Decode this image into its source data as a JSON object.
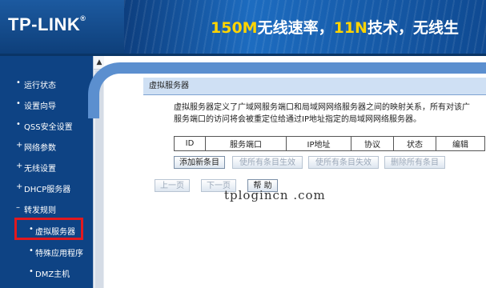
{
  "header": {
    "logo": "TP-LINK",
    "logo_reg": "®",
    "slogan_a": "150M",
    "slogan_b": "无线速率，",
    "slogan_c": "11N",
    "slogan_d": "技术，无线生"
  },
  "sidebar": {
    "items": [
      {
        "bullet": "•",
        "label": "运行状态"
      },
      {
        "bullet": "•",
        "label": "设置向导"
      },
      {
        "bullet": "•",
        "label": "QSS安全设置"
      },
      {
        "bullet": "+",
        "label": "网络参数"
      },
      {
        "bullet": "+",
        "label": "无线设置"
      },
      {
        "bullet": "+",
        "label": "DHCP服务器"
      },
      {
        "bullet": "–",
        "label": "转发规则"
      },
      {
        "bullet": "•",
        "label": "虚拟服务器"
      },
      {
        "bullet": "•",
        "label": "特殊应用程序"
      },
      {
        "bullet": "•",
        "label": "DMZ主机"
      }
    ]
  },
  "scrollbar": {
    "up_arrow": "▲"
  },
  "panel": {
    "title": "虚拟服务器",
    "desc_line1": "虚拟服务器定义了广域网服务端口和局域网网络服务器之间的映射关系，所有对该广",
    "desc_line2": "服务端口的访问将会被重定位给通过IP地址指定的局域网网络服务器。",
    "columns": [
      "ID",
      "服务端口",
      "IP地址",
      "协议",
      "状态",
      "编辑"
    ],
    "buttons": {
      "add": "添加新条目",
      "enable_all": "使所有条目生效",
      "disable_all": "使所有条目失效",
      "delete_all": "删除所有条目"
    },
    "nav": {
      "prev": "上一页",
      "next": "下一页",
      "help": "帮 助"
    }
  },
  "watermark": "tplogincn .com"
}
